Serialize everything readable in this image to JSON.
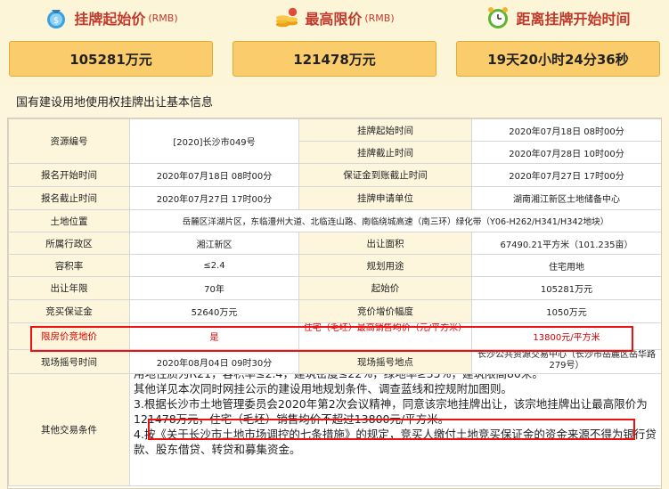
{
  "stats": [
    {
      "title": "挂牌起始价",
      "unit": "(RMB)",
      "value": "105281万元",
      "icon": "money-bag-icon"
    },
    {
      "title": "最高限价",
      "unit": "(RMB)",
      "value": "121478万元",
      "icon": "coin-stack-icon"
    },
    {
      "title": "距离挂牌开始时间",
      "unit": "",
      "value": "19天20小时24分36秒",
      "icon": "alarm-clock-icon"
    }
  ],
  "section_title": "国有建设用地使用权挂牌出让基本信息",
  "rows": {
    "r1": {
      "l1": "资源编号",
      "v1": "[2020]长沙市049号",
      "l2": "挂牌起始时间",
      "v2": "2020年07月18日 08时00分"
    },
    "r2": {
      "l2": "挂牌截止时间",
      "v2": "2020年07月28日 10时00分"
    },
    "r3": {
      "l1": "报名开始时间",
      "v1": "2020年07月18日 08时00分",
      "l2": "保证金到账截止时间",
      "v2": "2020年07月27日 17时00分"
    },
    "r4": {
      "l1": "报名截止时间",
      "v1": "2020年07月27日 17时00分",
      "l2": "挂牌申请单位",
      "v2": "湖南湘江新区土地储备中心"
    },
    "r5": {
      "l1": "土地位置",
      "v1": "岳麓区洋湖片区，东临澧州大道、北临连山路、南临绕城高速（南三环）绿化带（Y06-H262/H341/H342地块）"
    },
    "r6": {
      "l1": "所属行政区",
      "v1": "湘江新区",
      "l2": "出让面积",
      "v2": "67490.21平方米（101.235亩）"
    },
    "r7": {
      "l1": "容积率",
      "v1": "≤2.4",
      "l2": "规划用途",
      "v2": "住宅用地"
    },
    "r8": {
      "l1": "出让年限",
      "v1": "70年",
      "l2": "起始价",
      "v2": "105281万元"
    },
    "r9": {
      "l1": "竞买保证金",
      "v1": "52640万元",
      "l2": "竞价增价幅度",
      "v2": "1050万元"
    },
    "r10": {
      "l1": "限房价竞地价",
      "v1": "是",
      "l2": "住宅（毛坯）最高销售均价（元/平方米）",
      "v2": "13800元/平方米"
    },
    "r11": {
      "l1": "现场摇号时间",
      "v1": "2020年08月04日 09时30分",
      "l2": "现场摇号地点",
      "v2": "长沙公共资源交易中心（长沙市岳麓区岳华路279号）"
    },
    "r12": {
      "l1": "其他交易条件"
    }
  },
  "notes": [
    "用地性质为R21，容积率≤2.4，建筑密度≤22%，绿地率≥35%，建筑限高80米。",
    "其他详见本次同时网挂公示的建设用地规划条件、调查蓝线和控规附加图则。",
    "3.根据长沙市土地管理委员会2020年第2次会议精神，同意该宗地挂牌出让，该宗地挂牌出让最高限价为121478万元，住宅（毛坯）销售均价不超过13800元/平方米。",
    "4.按《关于长沙市土地市场调控的七条措施》的规定，竞买人缴付土地竞买保证金的资金来源不得为银行贷款、股东借贷、转贷和募集资金。"
  ],
  "colors": {
    "accent_red": "#d40000",
    "value_box": "#fbcc6b",
    "page_bg": "#fdf6dc"
  }
}
